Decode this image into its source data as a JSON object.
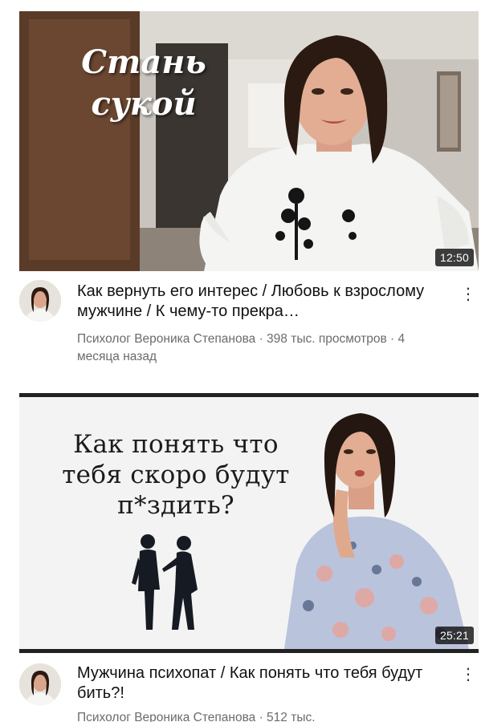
{
  "videos": [
    {
      "thumbnail_text_line1": "Стань",
      "thumbnail_text_line2": "сукой",
      "duration": "12:50",
      "title": "Как вернуть его интерес / Любовь к взрослому мужчине / К чему-то прекра…",
      "channel_and_views": "Психолог Вероника Степанова · 398 тыс. просмотров · 4 месяца назад"
    },
    {
      "thumbnail_text_line1": "Как понять что",
      "thumbnail_text_line2": "тебя скоро будут",
      "thumbnail_text_line3": "п*здить?",
      "duration": "25:21",
      "title": "Мужчина психопат / Как понять что тебя будут бить?!",
      "channel_and_views": "Психолог Вероника Степанова · 512 тыс."
    }
  ],
  "icons": {
    "more": "vertical-ellipsis-icon",
    "avatar": "channel-avatar"
  }
}
